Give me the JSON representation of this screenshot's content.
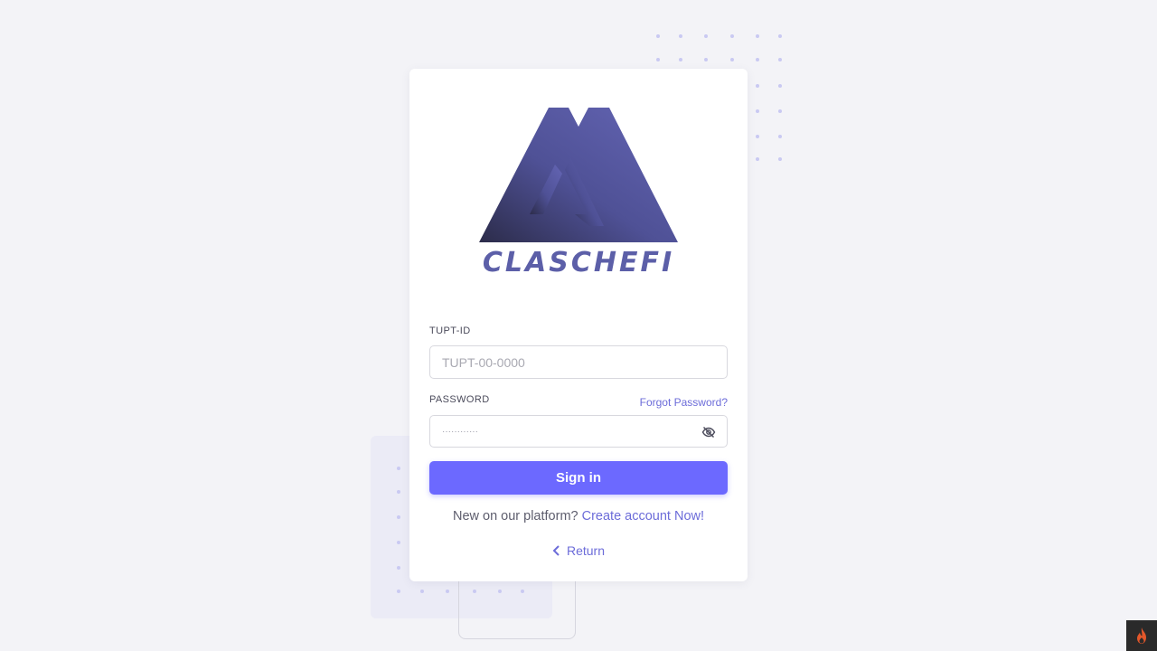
{
  "brand": {
    "logo_text": "CLASCHEFI",
    "primary_color": "#6c69ff",
    "logo_color": "#5c5fa8"
  },
  "form": {
    "id_label": "TUPT-ID",
    "id_placeholder": "TUPT-00-0000",
    "password_label": "PASSWORD",
    "password_value": "············",
    "forgot_label": "Forgot Password?",
    "password_toggle_icon": "eye-off-icon"
  },
  "actions": {
    "signin_label": "Sign in",
    "signup_prompt": "New on our platform?",
    "signup_link": "Create account Now!",
    "return_label": "Return"
  }
}
